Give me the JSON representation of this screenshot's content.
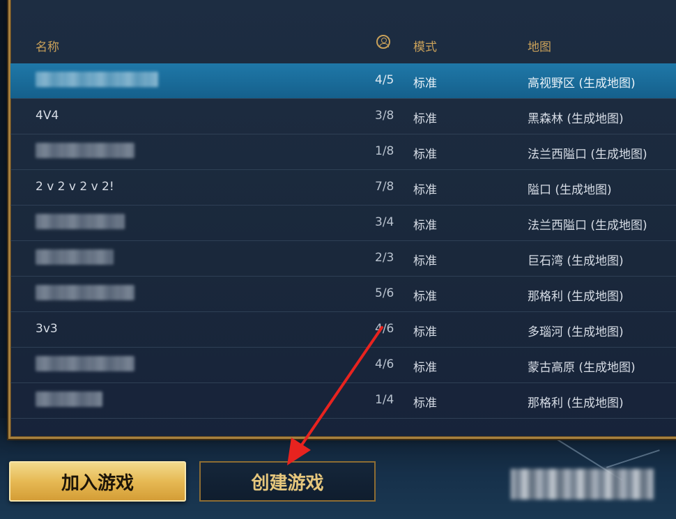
{
  "header": {
    "name_label": "名称",
    "mode_label": "模式",
    "map_label": "地图",
    "player_icon": "player-count-icon"
  },
  "rows": [
    {
      "name": "",
      "name_blurred": true,
      "players": "4/5",
      "mode": "标准",
      "map": "高视野区 (生成地图)",
      "selected": true
    },
    {
      "name": "4V4",
      "name_blurred": false,
      "players": "3/8",
      "mode": "标准",
      "map": "黑森林 (生成地图)"
    },
    {
      "name": "",
      "name_blurred": true,
      "players": "1/8",
      "mode": "标准",
      "map": "法兰西隘口 (生成地图)"
    },
    {
      "name": "2 v 2 v 2 v 2!",
      "name_blurred": false,
      "players": "7/8",
      "mode": "标准",
      "map": "隘口 (生成地图)"
    },
    {
      "name": "",
      "name_blurred": true,
      "players": "3/4",
      "mode": "标准",
      "map": "法兰西隘口 (生成地图)"
    },
    {
      "name": "",
      "name_blurred": true,
      "players": "2/3",
      "mode": "标准",
      "map": "巨石湾 (生成地图)"
    },
    {
      "name": "",
      "name_blurred": true,
      "players": "5/6",
      "mode": "标准",
      "map": "那格利 (生成地图)"
    },
    {
      "name": "3v3",
      "name_blurred": false,
      "players": "4/6",
      "mode": "标准",
      "map": "多瑙河 (生成地图)"
    },
    {
      "name": "",
      "name_blurred": true,
      "players": "4/6",
      "mode": "标准",
      "map": "蒙古高原 (生成地图)"
    },
    {
      "name": "",
      "name_blurred": true,
      "players": "1/4",
      "mode": "标准",
      "map": "那格利 (生成地图)"
    }
  ],
  "buttons": {
    "join": "加入游戏",
    "create": "创建游戏"
  },
  "colors": {
    "gold_accent": "#c9a15a",
    "selected_row": "#1f78a8",
    "annotation_arrow": "#e8231f"
  }
}
